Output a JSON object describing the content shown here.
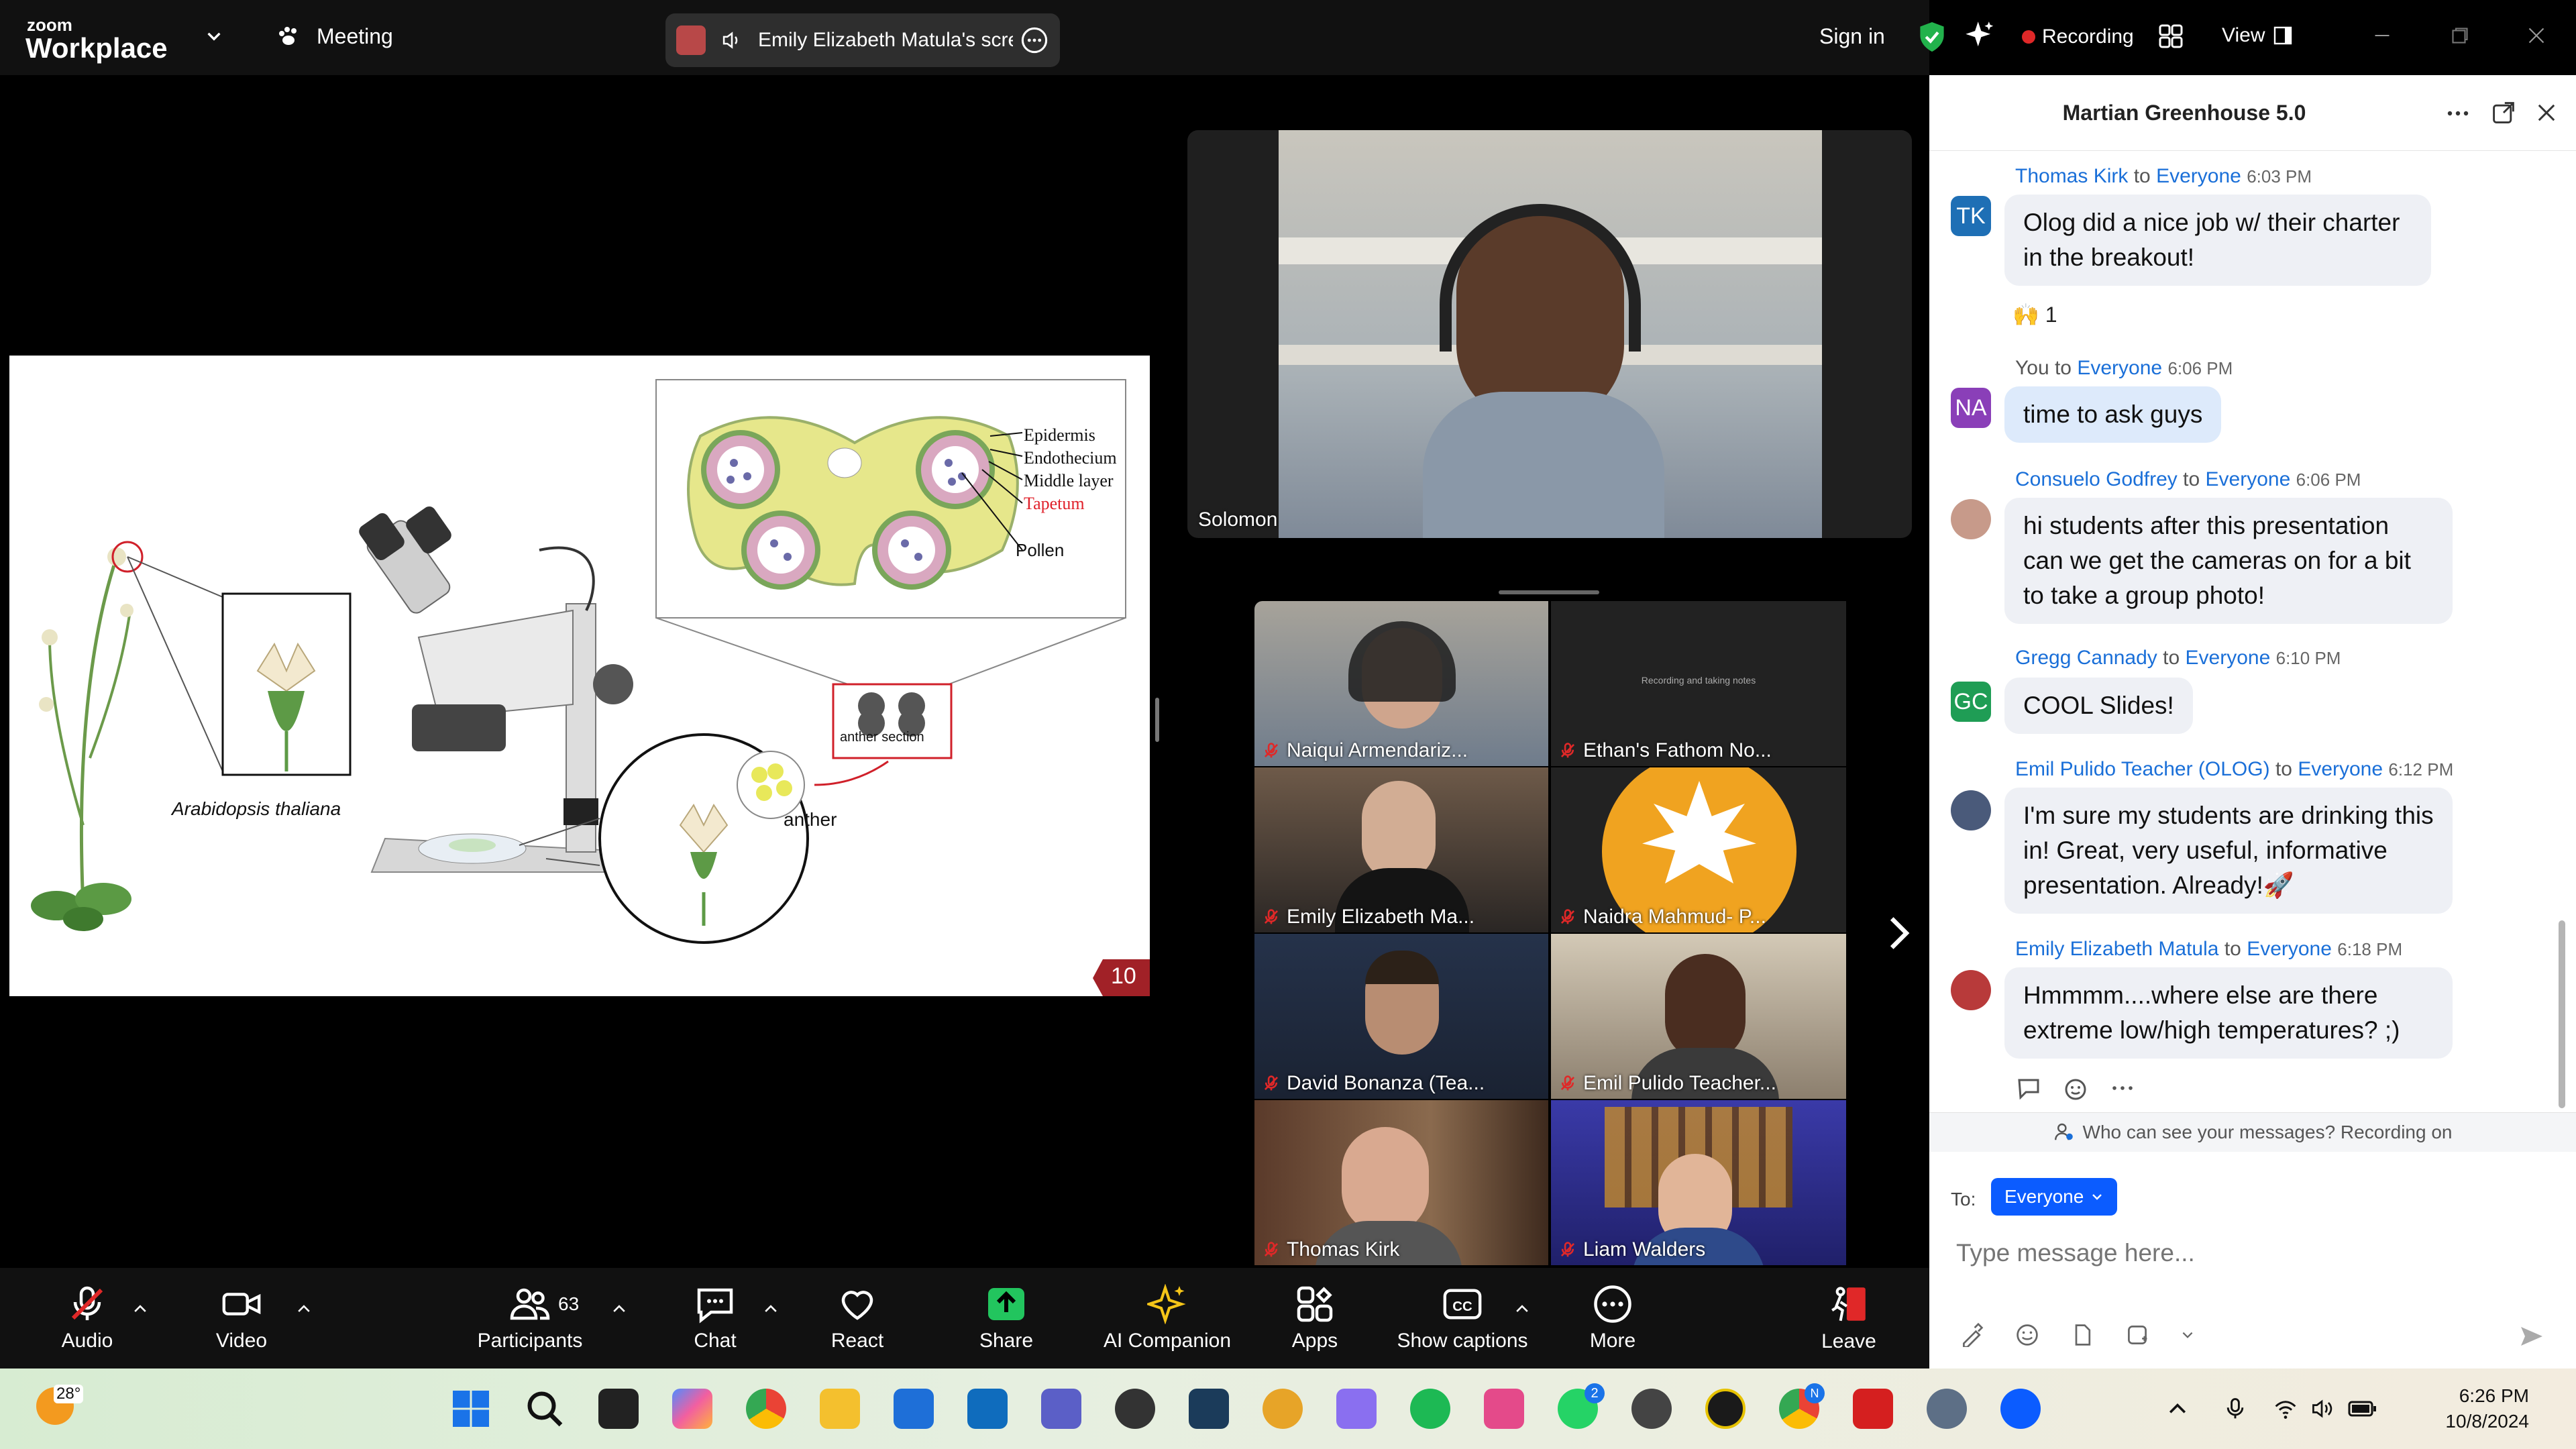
{
  "app": {
    "brand_small": "zoom",
    "brand_big": "Workplace",
    "meeting_label": "Meeting"
  },
  "share_pill": {
    "text": "Emily Elizabeth Matula's scre"
  },
  "topbar_right": {
    "sign_in": "Sign in",
    "recording": "Recording",
    "view": "View"
  },
  "slide": {
    "labels": [
      "Epidermis",
      "Endothecium",
      "Middle layer",
      "Tapetum",
      "Pollen"
    ],
    "species": "Arabidopsis thaliana",
    "anther_section": "anther section",
    "anther": "anther",
    "page_number": "10"
  },
  "speaker": {
    "name": "Solomon"
  },
  "participants": [
    {
      "name": "Naiqui Armendariz..."
    },
    {
      "name": "Ethan's Fathom No...",
      "note": "Recording and taking notes"
    },
    {
      "name": "Emily Elizabeth Ma..."
    },
    {
      "name": "Naidra Mahmud- P..."
    },
    {
      "name": "David Bonanza (Tea..."
    },
    {
      "name": "Emil Pulido Teacher..."
    },
    {
      "name": "Thomas Kirk"
    },
    {
      "name": "Liam Walders"
    }
  ],
  "chat": {
    "title": "Martian Greenhouse 5.0",
    "messages": [
      {
        "initials": "TK",
        "sender": "Thomas Kirk",
        "to": "to",
        "audience": "Everyone",
        "time": "6:03 PM",
        "text": "Olog did a nice job w/ their charter in the breakout!",
        "reaction": "🙌 1",
        "avatar_color": "#1e6fb5"
      },
      {
        "initials": "NA",
        "sender": "You",
        "to": "to",
        "audience": "Everyone",
        "time": "6:06 PM",
        "text": "time to ask guys",
        "avatar_color": "#8a3fb8"
      },
      {
        "initials": "",
        "sender": "Consuelo Godfrey",
        "to": "to",
        "audience": "Everyone",
        "time": "6:06 PM",
        "text": "hi students after this presentation can we get the cameras on for a bit to take a group photo!",
        "avatar_color": "#c79a8a"
      },
      {
        "initials": "GC",
        "sender": "Gregg Cannady",
        "to": "to",
        "audience": "Everyone",
        "time": "6:10 PM",
        "text": "COOL Slides!",
        "avatar_color": "#1f9d55"
      },
      {
        "initials": "",
        "sender": "Emil Pulido Teacher (OLOG)",
        "to": "to",
        "audience": "Everyone",
        "time": "6:12 PM",
        "text": "I'm sure my students are drinking this in! Great, very useful, informative presentation. Already!🚀",
        "avatar_color": "#4a5a7a"
      },
      {
        "initials": "",
        "sender": "Emily Elizabeth Matula",
        "to": "to",
        "audience": "Everyone",
        "time": "6:18 PM",
        "text": "Hmmmm....where else are there extreme low/high temperatures? ;)",
        "avatar_color": "#b83a3a"
      }
    ],
    "privacy_note": "Who can see your messages? Recording on",
    "to_label": "To:",
    "to_value": "Everyone",
    "input_placeholder": "Type message here..."
  },
  "toolbar": {
    "audio": "Audio",
    "video": "Video",
    "participants": "Participants",
    "participants_count": "63",
    "chat": "Chat",
    "react": "React",
    "share": "Share",
    "ai_companion": "AI Companion",
    "apps": "Apps",
    "show_captions": "Show captions",
    "more": "More",
    "leave": "Leave"
  },
  "taskbar": {
    "weather": "28°",
    "time": "6:26 PM",
    "date": "10/8/2024",
    "whatsapp_badge": "2",
    "badge_n": "N"
  },
  "colors": {
    "accent": "#0b5cff",
    "recording": "#e02828",
    "leave": "#e02828",
    "share": "#22c55e"
  }
}
